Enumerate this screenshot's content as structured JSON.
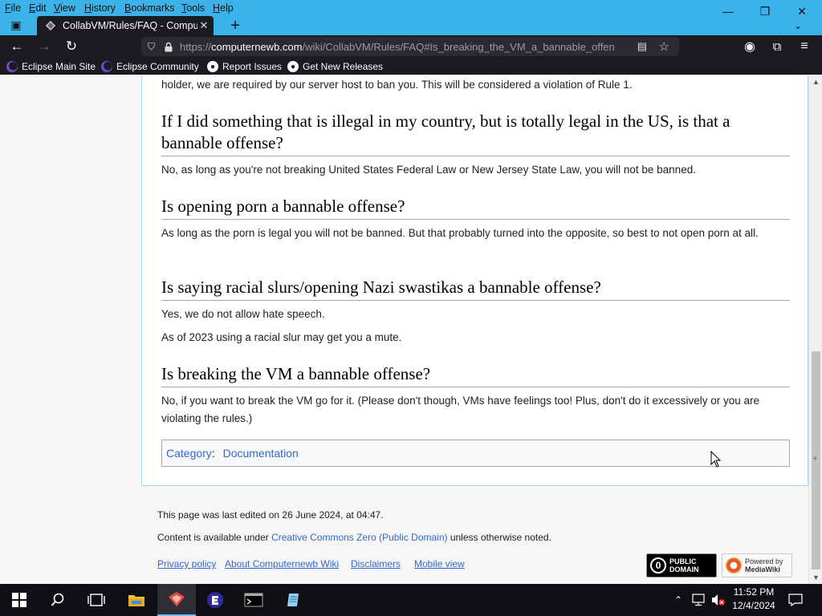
{
  "menubar": {
    "items": [
      "File",
      "Edit",
      "View",
      "History",
      "Bookmarks",
      "Tools",
      "Help"
    ],
    "accels": [
      "F",
      "E",
      "V",
      "H",
      "B",
      "T",
      "H"
    ]
  },
  "tab": {
    "title": "CollabVM/Rules/FAQ - Comput",
    "close": "✕"
  },
  "window_controls": {
    "minimize": "—",
    "restore": "❐",
    "close": "✕"
  },
  "nav": {
    "back": "←",
    "forward": "→",
    "reload": "↻",
    "url_prefix": "https://",
    "url_domain": "computernewb.com",
    "url_path": "/wiki/CollabVM/Rules/FAQ#Is_breaking_the_VM_a_bannable_offen"
  },
  "bookmarks": [
    {
      "label": "Eclipse Main Site",
      "icon": "eclipse-icon"
    },
    {
      "label": "Eclipse Community",
      "icon": "eclipse-icon"
    },
    {
      "label": "Report Issues",
      "icon": "github-icon"
    },
    {
      "label": "Get New Releases",
      "icon": "github-icon"
    }
  ],
  "article": {
    "intro": "holder, we are required by our server host to ban you. This will be considered a violation of Rule 1.",
    "sections": [
      {
        "heading": "If I did something that is illegal in my country, but is totally legal in the US, is that a bannable offense?",
        "paragraphs": [
          "No, as long as you're not breaking United States Federal Law or New Jersey State Law, you will not be banned."
        ]
      },
      {
        "heading": "Is opening porn a bannable offense?",
        "paragraphs": [
          "As long as the porn is legal you will not be banned. But that probably turned into the opposite, so best to not open porn at all."
        ]
      },
      {
        "heading": "Is saying racial slurs/opening Nazi swastikas a bannable offense?",
        "paragraphs": [
          "Yes, we do not allow hate speech.",
          "As of 2023 using a racial slur may get you a mute."
        ]
      },
      {
        "heading": "Is breaking the VM a bannable offense?",
        "paragraphs": [
          "No, if you want to break the VM go for it. (Please don't though, VMs have feelings too! Plus, don't do it excessively or you are violating the rules.)"
        ]
      }
    ],
    "category_label": "Category",
    "category_separator": ":",
    "category_value": "Documentation"
  },
  "footer": {
    "last_edited": "This page was last edited on 26 June 2024, at 04:47.",
    "license_prefix": "Content is available under ",
    "license_link": "Creative Commons Zero (Public Domain)",
    "license_suffix": " unless otherwise noted.",
    "links": [
      "Privacy policy",
      "About Computernewb Wiki",
      "Disclaimers",
      "Mobile view"
    ],
    "badge_pd_line1": "PUBLIC",
    "badge_pd_line2": "DOMAIN",
    "badge_mw_line1": "Powered by",
    "badge_mw_line2": "MediaWiki"
  },
  "taskbar": {
    "time": "11:52 PM",
    "date": "12/4/2024"
  },
  "colors": {
    "accent": "#3cb3e8",
    "link": "#3366cc",
    "chrome_dark": "#1c1b22"
  }
}
